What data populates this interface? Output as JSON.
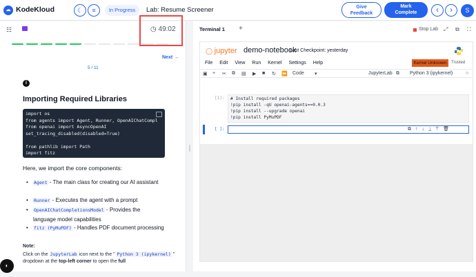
{
  "topbar": {
    "brand": "KodeKloud",
    "logo_icon": "kodekloud-logo-icon",
    "status_pill": "In Progress",
    "lab_title": "Lab: Resume Screener",
    "feedback_line1": "Give",
    "feedback_line2": "Feedback",
    "mark_line1": "Mark",
    "mark_line2": "Complete",
    "prev_icon": "‹",
    "next_icon": "›",
    "avatar": "S"
  },
  "left": {
    "timer": "49:02",
    "next_link": "Next →",
    "page_indicator": "5 / 11",
    "heading": "Importing Required Libraries",
    "code": "import os\nfrom agents import Agent, Runner, OpenAIChatCompl\nfrom openai import AsyncOpenAI\nset_tracing_disabled(disabled=True)\n\nfrom pathlib import Path\nimport fitz",
    "intro": "Here, we import the core components:",
    "bullets": [
      {
        "code": "Agent",
        "text": " - The main class for creating our AI assistant"
      },
      {
        "code": "Runner",
        "text": " - Executes the agent with a prompt"
      },
      {
        "code": "OpenAIChatCompletionsModel",
        "text": " - Provides the language model capabilities"
      },
      {
        "code": "fitz (PyMuPDF)",
        "text": " - Handles PDF document processing"
      }
    ],
    "note_label": "Note:",
    "note_pre": "Click on the ",
    "note_code1": "JupyterLab",
    "note_mid": " icon next to the \" ",
    "note_code2": "Python 3 (ipykernel)",
    "note_post": " \" dropdown at the ",
    "note_bold1": "top-left corner",
    "note_end": " to open the ",
    "note_bold2": "full"
  },
  "right": {
    "tab": "Terminal 1",
    "plus": "+",
    "stop_label": "Stop Lab",
    "notebook": {
      "jupyter": "jupyter",
      "name": "demo-notebook",
      "checkpoint": "Last Checkpoint: yesterday",
      "menu": [
        "File",
        "Edit",
        "View",
        "Run",
        "Kernel",
        "Settings",
        "Help"
      ],
      "kernel_status": "Kernel Unknown",
      "trusted": "Trusted",
      "cell_type": "Code",
      "jupyterlab": "JupyterLab",
      "kernel": "Python 3 (ipykernel)",
      "cell1_prompt": "[1]:",
      "cell1_code": "# Install required packages\n!pip install -qU openai-agents==0.0.3\n!pip install --upgrade openai\n!pip install PyMuPDF",
      "cell2_prompt": "[ ]:"
    }
  },
  "colors": {
    "accent": "#2563eb",
    "kernel_unknown": "#e25a1c",
    "highlight_box": "#ef4444"
  }
}
